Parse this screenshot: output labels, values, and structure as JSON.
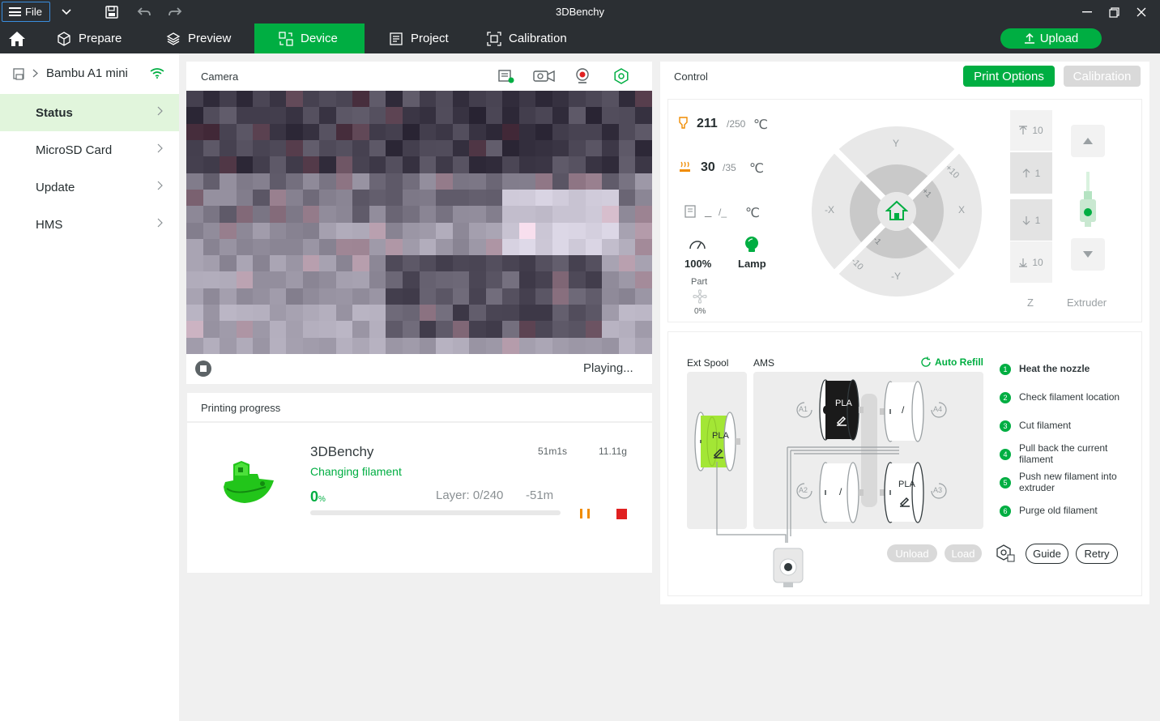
{
  "window": {
    "title": "3DBenchy",
    "file_label": "File"
  },
  "nav": {
    "tabs": [
      {
        "label": "Prepare",
        "icon": "cube-icon"
      },
      {
        "label": "Preview",
        "icon": "layers-icon"
      },
      {
        "label": "Device",
        "icon": "device-icon",
        "active": true
      },
      {
        "label": "Project",
        "icon": "project-icon"
      },
      {
        "label": "Calibration",
        "icon": "calibration-icon"
      }
    ],
    "upload_label": "Upload"
  },
  "sidebar": {
    "device_name": "Bambu A1 mini",
    "items": [
      {
        "label": "Status",
        "active": true
      },
      {
        "label": "MicroSD Card"
      },
      {
        "label": "Update"
      },
      {
        "label": "HMS"
      }
    ]
  },
  "camera": {
    "title": "Camera",
    "status": "Playing..."
  },
  "progress": {
    "title": "Printing progress",
    "file_name": "3DBenchy",
    "state": "Changing filament",
    "time": "51m1s",
    "weight": "11.11g",
    "percent": "0",
    "percent_unit": "%",
    "percent_value": 0,
    "layer": "Layer: 0/240",
    "remaining": "-51m"
  },
  "control": {
    "title": "Control",
    "print_options_label": "Print Options",
    "calibration_label": "Calibration",
    "nozzle": {
      "current": "211",
      "target": "/250",
      "unit": "℃"
    },
    "bed": {
      "current": "30",
      "target": "/35",
      "unit": "℃"
    },
    "chamber": {
      "current": "_",
      "target": "/_",
      "unit": "℃"
    },
    "speed": "100%",
    "lamp_label": "Lamp",
    "part_label": "Part",
    "part_value": "0%",
    "jog": {
      "y_pos": "Y",
      "y_neg": "-Y",
      "x_pos": "X",
      "x_neg": "-X",
      "plus10": "+10",
      "plus1": "+1",
      "minus1": "-1",
      "minus10": "-10"
    },
    "z": {
      "label": "Z",
      "buttons": [
        "10",
        "1",
        "1",
        "10"
      ]
    },
    "extruder_label": "Extruder"
  },
  "ams": {
    "ext_spool_label": "Ext Spool",
    "ams_label": "AMS",
    "auto_refill_label": "Auto Refill",
    "slots": [
      {
        "id": "A1",
        "material": "PLA",
        "color": "#1a1a1a"
      },
      {
        "id": "A2",
        "material": "/",
        "color": "#ffffff"
      },
      {
        "id": "A3",
        "material": "PLA",
        "color": "#ffffff"
      },
      {
        "id": "A4",
        "material": "/",
        "color": "#ffffff"
      }
    ],
    "ext_material": "PLA",
    "ext_color": "#a3e635",
    "unload_label": "Unload",
    "load_label": "Load",
    "guide_label": "Guide",
    "retry_label": "Retry",
    "steps": [
      {
        "num": "1",
        "label": "Heat the nozzle",
        "bold": true
      },
      {
        "num": "2",
        "label": "Check filament location"
      },
      {
        "num": "3",
        "label": "Cut filament"
      },
      {
        "num": "4",
        "label": "Pull back the current filament"
      },
      {
        "num": "5",
        "label": "Push new filament into extruder"
      },
      {
        "num": "6",
        "label": "Purge old filament"
      }
    ]
  },
  "colors": {
    "accent": "#00ae42",
    "titlebar": "#2b2f33",
    "sidebar_active": "#e1f5dc",
    "stop_red": "#e02020",
    "pause_orange": "#f08c00"
  }
}
